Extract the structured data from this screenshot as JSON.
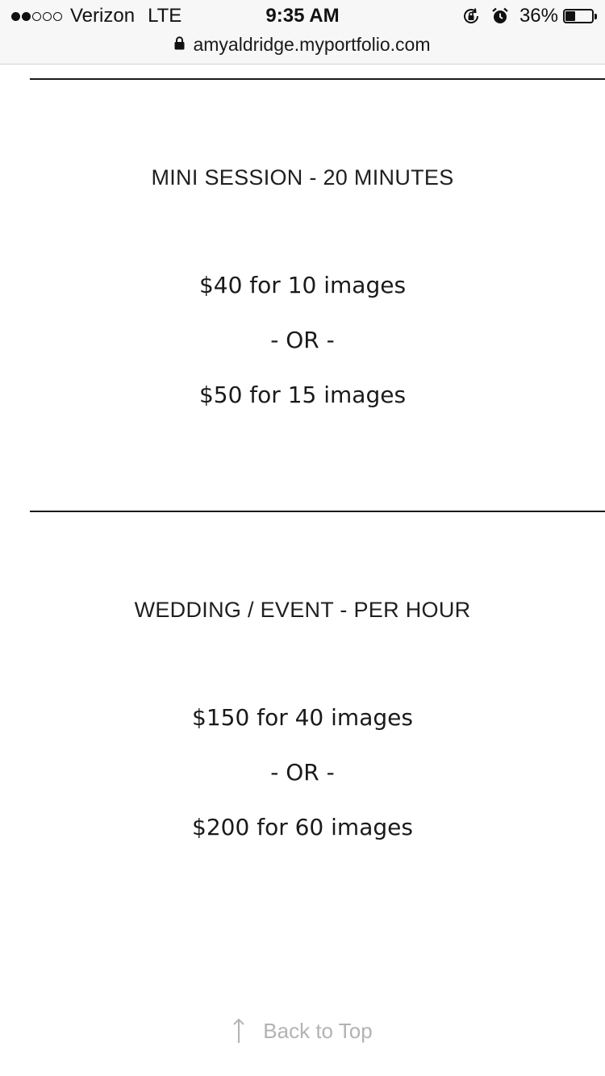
{
  "status_bar": {
    "signal_dots": [
      "full",
      "full",
      "empty",
      "empty",
      "empty"
    ],
    "carrier": "Verizon",
    "network": "LTE",
    "time": "9:35 AM",
    "icons": [
      "orientation-lock-icon",
      "alarm-icon"
    ],
    "battery_percent": "36%",
    "battery_level": 0.36
  },
  "browser": {
    "url": "amyaldridge.myportfolio.com",
    "lock_icon": "lock-icon"
  },
  "page": {
    "sections": [
      {
        "heading": "MINI SESSION - 20 MINUTES",
        "option1": "$40 for 10 images",
        "separator": "- OR -",
        "option2": "$50 for 15 images"
      },
      {
        "heading": "WEDDING / EVENT - PER HOUR",
        "option1": "$150 for 40 images",
        "separator": "- OR -",
        "option2": "$200 for 60 images"
      }
    ],
    "back_to_top": {
      "label": "Back to Top",
      "icon": "arrow-up-icon"
    }
  },
  "colors": {
    "text": "#1a1a1a",
    "muted": "#b3b3b3",
    "bar_background": "#f7f7f7"
  }
}
